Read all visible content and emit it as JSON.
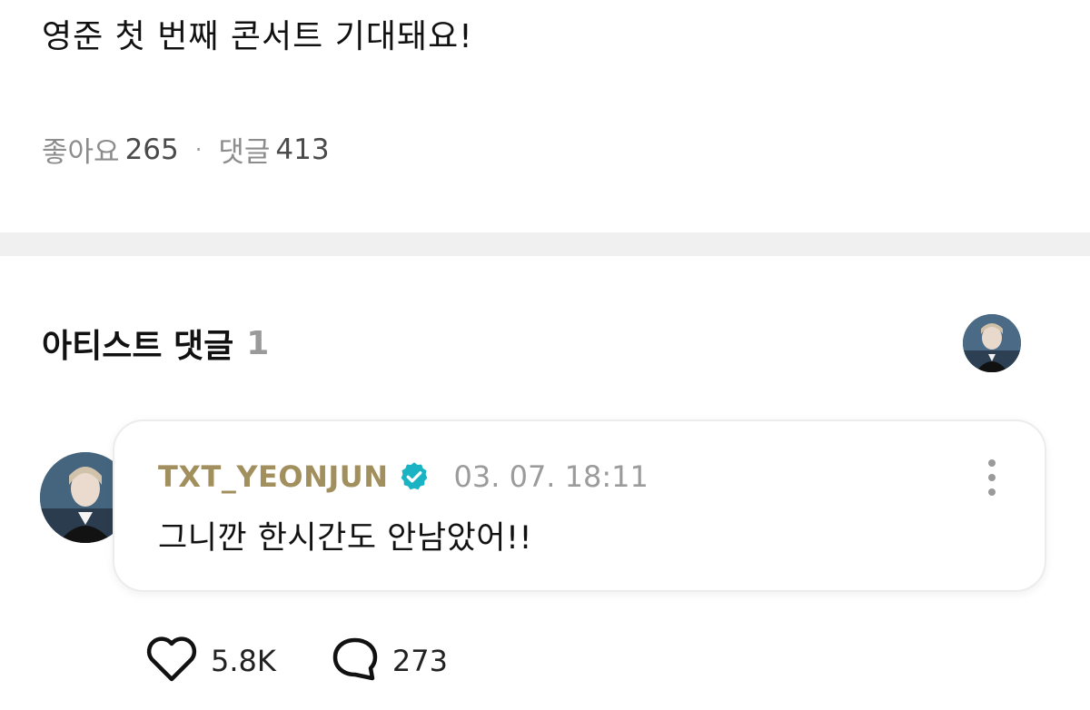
{
  "post": {
    "text": "영준 첫 번째 콘서트 기대돼요!",
    "likes_label": "좋아요",
    "likes_count": "265",
    "comments_label": "댓글",
    "comments_count": "413",
    "separator": "·"
  },
  "artist_comments": {
    "title": "아티스트 댓글",
    "count": "1",
    "items": [
      {
        "author": "TXT_YEONJUN",
        "timestamp": "03. 07. 18:11",
        "text": "그니깐 한시간도 안남았어!!",
        "likes": "5.8K",
        "replies": "273"
      }
    ]
  },
  "colors": {
    "author": "#a28f5e",
    "verified": "#1ab3c4",
    "divider": "#f0f0f0"
  },
  "icons": {
    "verified": "verified-badge-icon",
    "more": "more-vertical-icon",
    "like": "heart-outline-icon",
    "reply": "speech-bubble-icon"
  }
}
